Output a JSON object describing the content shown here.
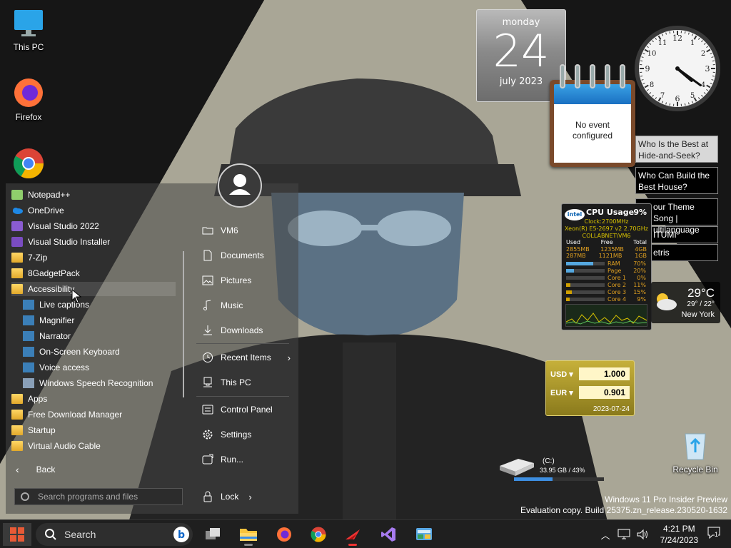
{
  "desktop": {
    "icons": [
      {
        "label": "This PC",
        "icon": "monitor-icon"
      },
      {
        "label": "Firefox",
        "icon": "firefox-icon"
      },
      {
        "label": "Google Chrome",
        "icon": "chrome-icon"
      },
      {
        "label": "Notepad++",
        "icon": "notepad-icon"
      },
      {
        "label": "Free Download Manager",
        "icon": "fdm-icon"
      },
      {
        "label": "Free...",
        "icon": "app-icon"
      }
    ],
    "recycle_bin": {
      "label": "Recycle Bin",
      "icon": "recycle-bin-icon"
    }
  },
  "gadgets": {
    "calendar": {
      "day": "monday",
      "date": "24",
      "month": "july 2023"
    },
    "notes": {
      "text_line1": "No event",
      "text_line2": "configured"
    },
    "clock": {
      "hour": 4,
      "minute": 21
    },
    "rss": [
      "Who Is the Best at Hide-and-Seek?",
      "Who Can Build the Best House?",
      "our Theme Song | ultilanguage",
      "ITUMI",
      "etris"
    ],
    "cpu": {
      "brand": "intel",
      "title": "CPU Usage",
      "percent": "9%",
      "clock": "Clock:2700MHz",
      "model": "Xeon(R) E5-2697 v2 2.70GHz",
      "host": "COLLABNET\\VM6",
      "mem_headers": [
        "Used",
        "Free",
        "Total"
      ],
      "mem_rows": [
        [
          "2855MB",
          "1235MB",
          "4GB"
        ],
        [
          "287MB",
          "1121MB",
          "1GB"
        ]
      ],
      "bars": [
        {
          "label": "RAM",
          "value": "70%",
          "fill": 70
        },
        {
          "label": "Page",
          "value": "20%",
          "fill": 20
        },
        {
          "label": "Core 1",
          "value": "0%",
          "fill": 0
        },
        {
          "label": "Core 2",
          "value": "11%",
          "fill": 11
        },
        {
          "label": "Core 3",
          "value": "15%",
          "fill": 15
        },
        {
          "label": "Core 4",
          "value": "9%",
          "fill": 9
        }
      ]
    },
    "weather": {
      "temp": "29°C",
      "range": "29° / 22°",
      "city": "New York"
    },
    "currency": {
      "from_code": "USD",
      "from_value": "1.000",
      "to_code": "EUR",
      "to_value": "0.901",
      "date": "2023-07-24"
    },
    "drive": {
      "label": "(C:)",
      "size": "33.95 GB / 43%",
      "used_percent": 43
    }
  },
  "start_menu": {
    "programs": [
      {
        "label": "Notepad++",
        "kind": "app"
      },
      {
        "label": "OneDrive",
        "kind": "app"
      },
      {
        "label": "Visual Studio 2022",
        "kind": "app"
      },
      {
        "label": "Visual Studio Installer",
        "kind": "app"
      },
      {
        "label": "7-Zip",
        "kind": "folder"
      },
      {
        "label": "8GadgetPack",
        "kind": "folder"
      },
      {
        "label": "Accessibility",
        "kind": "folder"
      },
      {
        "label": "Live captions",
        "kind": "sub"
      },
      {
        "label": "Magnifier",
        "kind": "sub"
      },
      {
        "label": "Narrator",
        "kind": "sub"
      },
      {
        "label": "On-Screen Keyboard",
        "kind": "sub"
      },
      {
        "label": "Voice access",
        "kind": "sub"
      },
      {
        "label": "Windows Speech Recognition",
        "kind": "sub"
      },
      {
        "label": "Apps",
        "kind": "folder"
      },
      {
        "label": "Free Download Manager",
        "kind": "folder"
      },
      {
        "label": "Startup",
        "kind": "folder"
      },
      {
        "label": "Virtual Audio Cable",
        "kind": "folder"
      }
    ],
    "back_label": "Back",
    "search_placeholder": "Search programs and files",
    "right_links": [
      {
        "label": "VM6",
        "icon": "folder-outline-icon"
      },
      {
        "label": "Documents",
        "icon": "document-icon"
      },
      {
        "label": "Pictures",
        "icon": "picture-icon"
      },
      {
        "label": "Music",
        "icon": "music-icon"
      },
      {
        "label": "Downloads",
        "icon": "download-icon"
      },
      {
        "label": "Recent Items",
        "icon": "clock-icon"
      },
      {
        "label": "This PC",
        "icon": "computer-icon"
      },
      {
        "label": "Control Panel",
        "icon": "control-panel-icon"
      },
      {
        "label": "Settings",
        "icon": "gear-icon"
      },
      {
        "label": "Run...",
        "icon": "run-icon"
      }
    ],
    "lock_label": "Lock"
  },
  "watermark": {
    "line1": "Windows 11 Pro Insider Preview",
    "line2": "Evaluation copy. Build 25375.zn_release.230520-1632"
  },
  "taskbar": {
    "search_label": "Search",
    "apps": [
      "task-view-icon",
      "file-explorer-icon",
      "firefox-icon",
      "chrome-icon",
      "app-arrow-icon",
      "visual-studio-icon",
      "control-panel-icon"
    ],
    "time": "4:21 PM",
    "date": "7/24/2023",
    "notification_count": "1"
  }
}
